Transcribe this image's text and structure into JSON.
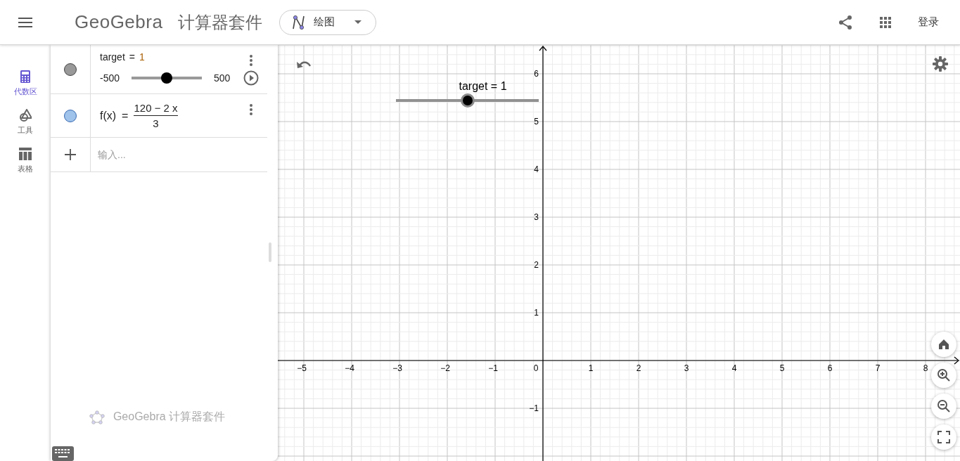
{
  "header": {
    "brand": "GeoGebra",
    "app_title": "计算器套件",
    "app_switcher": {
      "label": "绘图"
    },
    "login": "登录"
  },
  "sidebar": {
    "items": [
      {
        "label": "代数区",
        "kind": "calculator",
        "selected": true
      },
      {
        "label": "工具",
        "kind": "tools",
        "selected": false
      },
      {
        "label": "表格",
        "kind": "table",
        "selected": false
      }
    ]
  },
  "algebra": {
    "items": [
      {
        "kind": "slider",
        "color": "#999999",
        "lhs": "target",
        "operator": "=",
        "rhs": "1",
        "min": "-500",
        "max": "500",
        "level": 0.5
      },
      {
        "kind": "function",
        "color": "#9fc3ea",
        "lhs": "f(x)",
        "operator": "=",
        "numerator": "120 − 2 x",
        "denominator": "3"
      }
    ],
    "input": {
      "placeholder": "输入..."
    },
    "footer": "GeoGebra 计算器套件"
  },
  "graphics": {
    "slider": {
      "label": "target = 1",
      "level": 0.5
    },
    "x_labels": [
      "−5",
      "−4",
      "−3",
      "−2",
      "−1",
      "0",
      "1",
      "2",
      "3",
      "4",
      "5",
      "6",
      "7",
      "8"
    ],
    "y_labels": [
      "6",
      "5",
      "4",
      "3",
      "2",
      "1",
      "−1"
    ]
  }
}
